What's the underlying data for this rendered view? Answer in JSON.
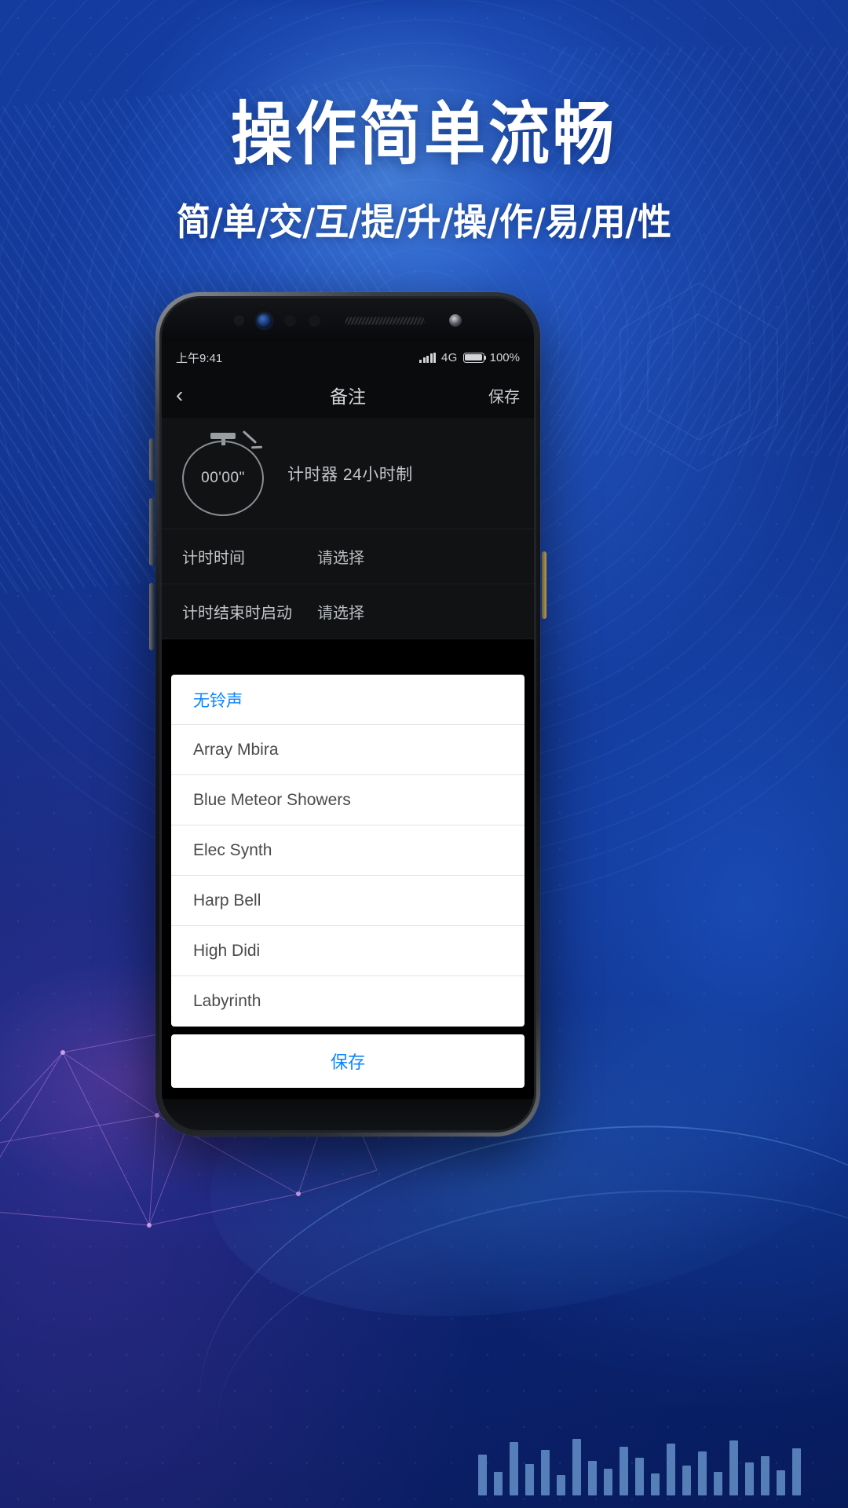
{
  "poster": {
    "title": "操作简单流畅",
    "subtitle": "简/单/交/互/提/升/操/作/易/用/性",
    "accent_blue": "#0a84ff",
    "bg_blue": "#0d2a7d"
  },
  "phone": {
    "statusbar": {
      "time": "上午9:41",
      "network": "4G",
      "battery_percent": "100%"
    },
    "navbar": {
      "back_icon": "chevron-left-icon",
      "title": "备注",
      "action": "保存"
    },
    "timer_card": {
      "display": "00'00\"",
      "label": "计时器  24小时制",
      "icon": "stopwatch-icon"
    },
    "settings": [
      {
        "key": "计时时间",
        "value": "请选择"
      },
      {
        "key": "计时结束时启动",
        "value": "请选择"
      }
    ],
    "ringtone_sheet": {
      "items": [
        {
          "label": "无铃声",
          "selected": true
        },
        {
          "label": "Array Mbira",
          "selected": false
        },
        {
          "label": "Blue Meteor Showers",
          "selected": false
        },
        {
          "label": "Elec Synth",
          "selected": false
        },
        {
          "label": "Harp Bell",
          "selected": false
        },
        {
          "label": "High Didi",
          "selected": false
        },
        {
          "label": "Labyrinth",
          "selected": false
        }
      ],
      "save_label": "保存"
    }
  }
}
